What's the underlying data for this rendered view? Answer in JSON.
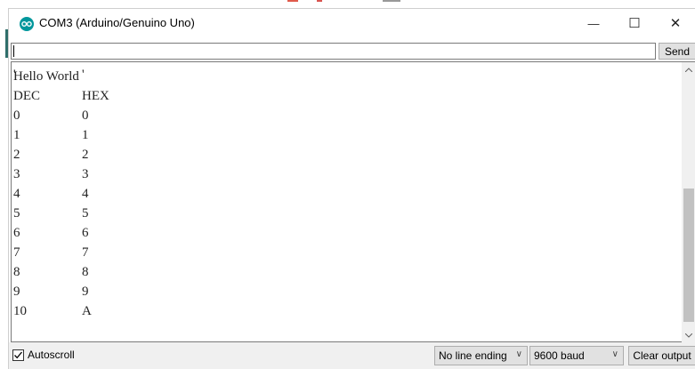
{
  "window": {
    "title": "COM3 (Arduino/Genuino Uno)",
    "minimize_glyph": "—",
    "maximize_glyph": "☐",
    "close_glyph": "✕",
    "icon": "arduino-infinity-icon",
    "accent_color": "#00979c"
  },
  "send_row": {
    "input_value": "",
    "send_label": "Send"
  },
  "output": {
    "lines": [
      {
        "a": "Hello World",
        "b": ""
      },
      {
        "a": "DEC",
        "b": "HEX"
      },
      {
        "a": "0",
        "b": "0"
      },
      {
        "a": "1",
        "b": "1"
      },
      {
        "a": "2",
        "b": "2"
      },
      {
        "a": "3",
        "b": "3"
      },
      {
        "a": "4",
        "b": "4"
      },
      {
        "a": "5",
        "b": "5"
      },
      {
        "a": "6",
        "b": "6"
      },
      {
        "a": "7",
        "b": "7"
      },
      {
        "a": "8",
        "b": "8"
      },
      {
        "a": "9",
        "b": "9"
      },
      {
        "a": "10",
        "b": "A"
      }
    ]
  },
  "bottom_bar": {
    "autoscroll_label": "Autoscroll",
    "autoscroll_checked": true,
    "line_ending": "No line ending",
    "baud": "9600 baud",
    "clear_label": "Clear output"
  }
}
